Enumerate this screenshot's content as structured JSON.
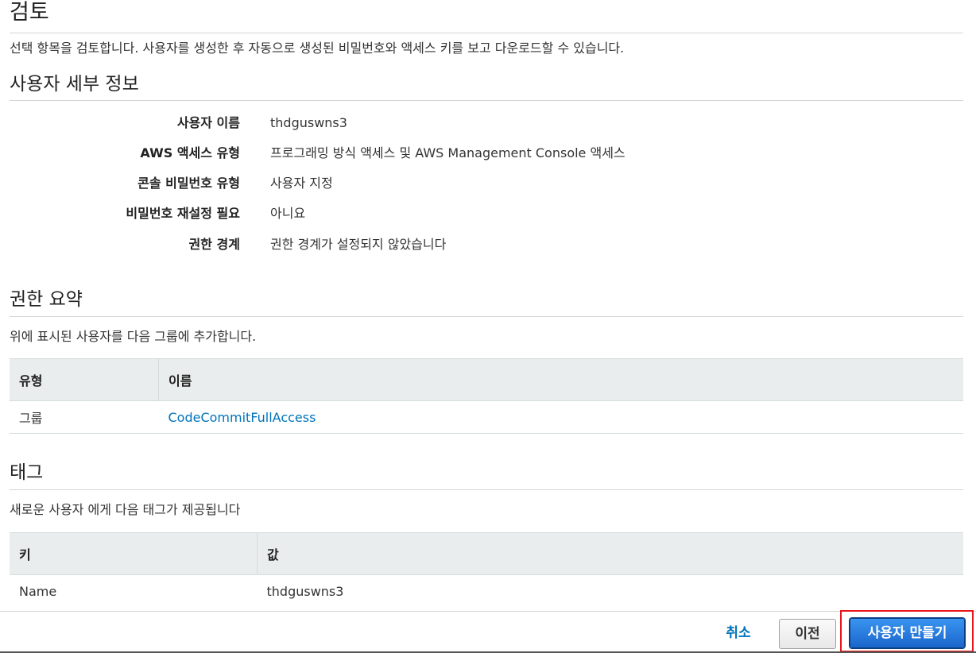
{
  "review": {
    "title": "검토",
    "description": "선택 항목을 검토합니다. 사용자를 생성한 후 자동으로 생성된 비밀번호와 액세스 키를 보고 다운로드할 수 있습니다."
  },
  "user_details": {
    "title": "사용자 세부 정보",
    "rows": [
      {
        "label": "사용자 이름",
        "value": "thdguswns3"
      },
      {
        "label": "AWS 액세스 유형",
        "value": "프로그래밍 방식 액세스 및 AWS Management Console 액세스"
      },
      {
        "label": "콘솔 비밀번호 유형",
        "value": "사용자 지정"
      },
      {
        "label": "비밀번호 재설정 필요",
        "value": "아니요"
      },
      {
        "label": "권한 경계",
        "value": "권한 경계가 설정되지 않았습니다"
      }
    ]
  },
  "permissions": {
    "title": "권한 요약",
    "description": "위에 표시된 사용자를 다음 그룹에 추가합니다.",
    "headers": [
      "유형",
      "이름"
    ],
    "rows": [
      {
        "type": "그룹",
        "name": "CodeCommitFullAccess"
      }
    ]
  },
  "tags": {
    "title": "태그",
    "description": "새로운 사용자 에게 다음 태그가 제공됩니다",
    "headers": [
      "키",
      "값"
    ],
    "rows": [
      {
        "key": "Name",
        "value": "thdguswns3"
      }
    ]
  },
  "footer": {
    "cancel_label": "취소",
    "previous_label": "이전",
    "create_label": "사용자 만들기"
  },
  "colors": {
    "link": "#0073bb",
    "primary_button": "#1a66cc",
    "highlight_box": "#e8141b",
    "table_header_bg": "#eaeded"
  }
}
